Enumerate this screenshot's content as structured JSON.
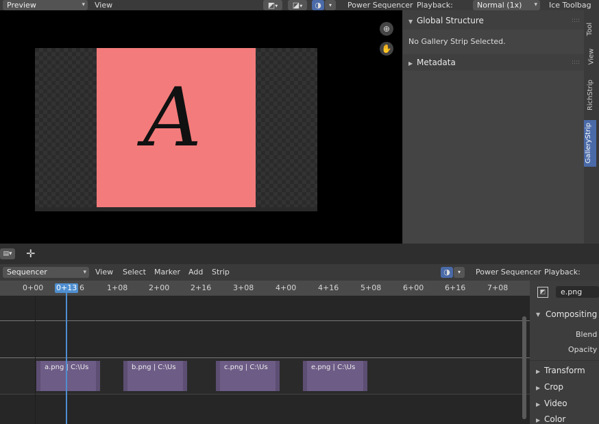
{
  "top_header": {
    "preview_label": "Preview",
    "view_menu": "View",
    "power_sequencer": "Power Sequencer",
    "playback_label": "Playback:",
    "playback_value": "Normal (1x)",
    "ice_toolbag": "Ice Toolbag"
  },
  "sidebar": {
    "global_structure": "Global Structure",
    "no_strip_selected": "No Gallery Strip Selected.",
    "metadata": "Metadata",
    "tabs": [
      "Tool",
      "View",
      "RichStrip",
      "GalleryStrip"
    ]
  },
  "preview": {
    "glyph": "A",
    "canvas_color": "#f47b7b"
  },
  "seq_header": {
    "editor_type": "Sequencer",
    "menus": [
      "View",
      "Select",
      "Marker",
      "Add",
      "Strip"
    ],
    "power_sequencer": "Power Sequencer",
    "playback_label": "Playback:"
  },
  "timeline": {
    "current_frame": "0+13",
    "ticks": [
      "0+00",
      "6",
      "1+08",
      "2+00",
      "2+16",
      "3+08",
      "4+00",
      "4+16",
      "5+08",
      "6+00",
      "6+16",
      "7+08"
    ]
  },
  "strips": [
    {
      "label": "a.png | C:\\Us"
    },
    {
      "label": "b.png | C:\\Us"
    },
    {
      "label": "c.png | C:\\Us"
    },
    {
      "label": "e.png | C:\\Us"
    }
  ],
  "properties": {
    "strip_name": "e.png",
    "compositing": "Compositing",
    "blend": "Blend",
    "opacity": "Opacity",
    "sections": [
      "Transform",
      "Crop",
      "Video",
      "Color"
    ]
  },
  "colors": {
    "strip": "#6d5c86",
    "playhead": "#4f8fd0",
    "active_tab": "#4a6aa8"
  }
}
